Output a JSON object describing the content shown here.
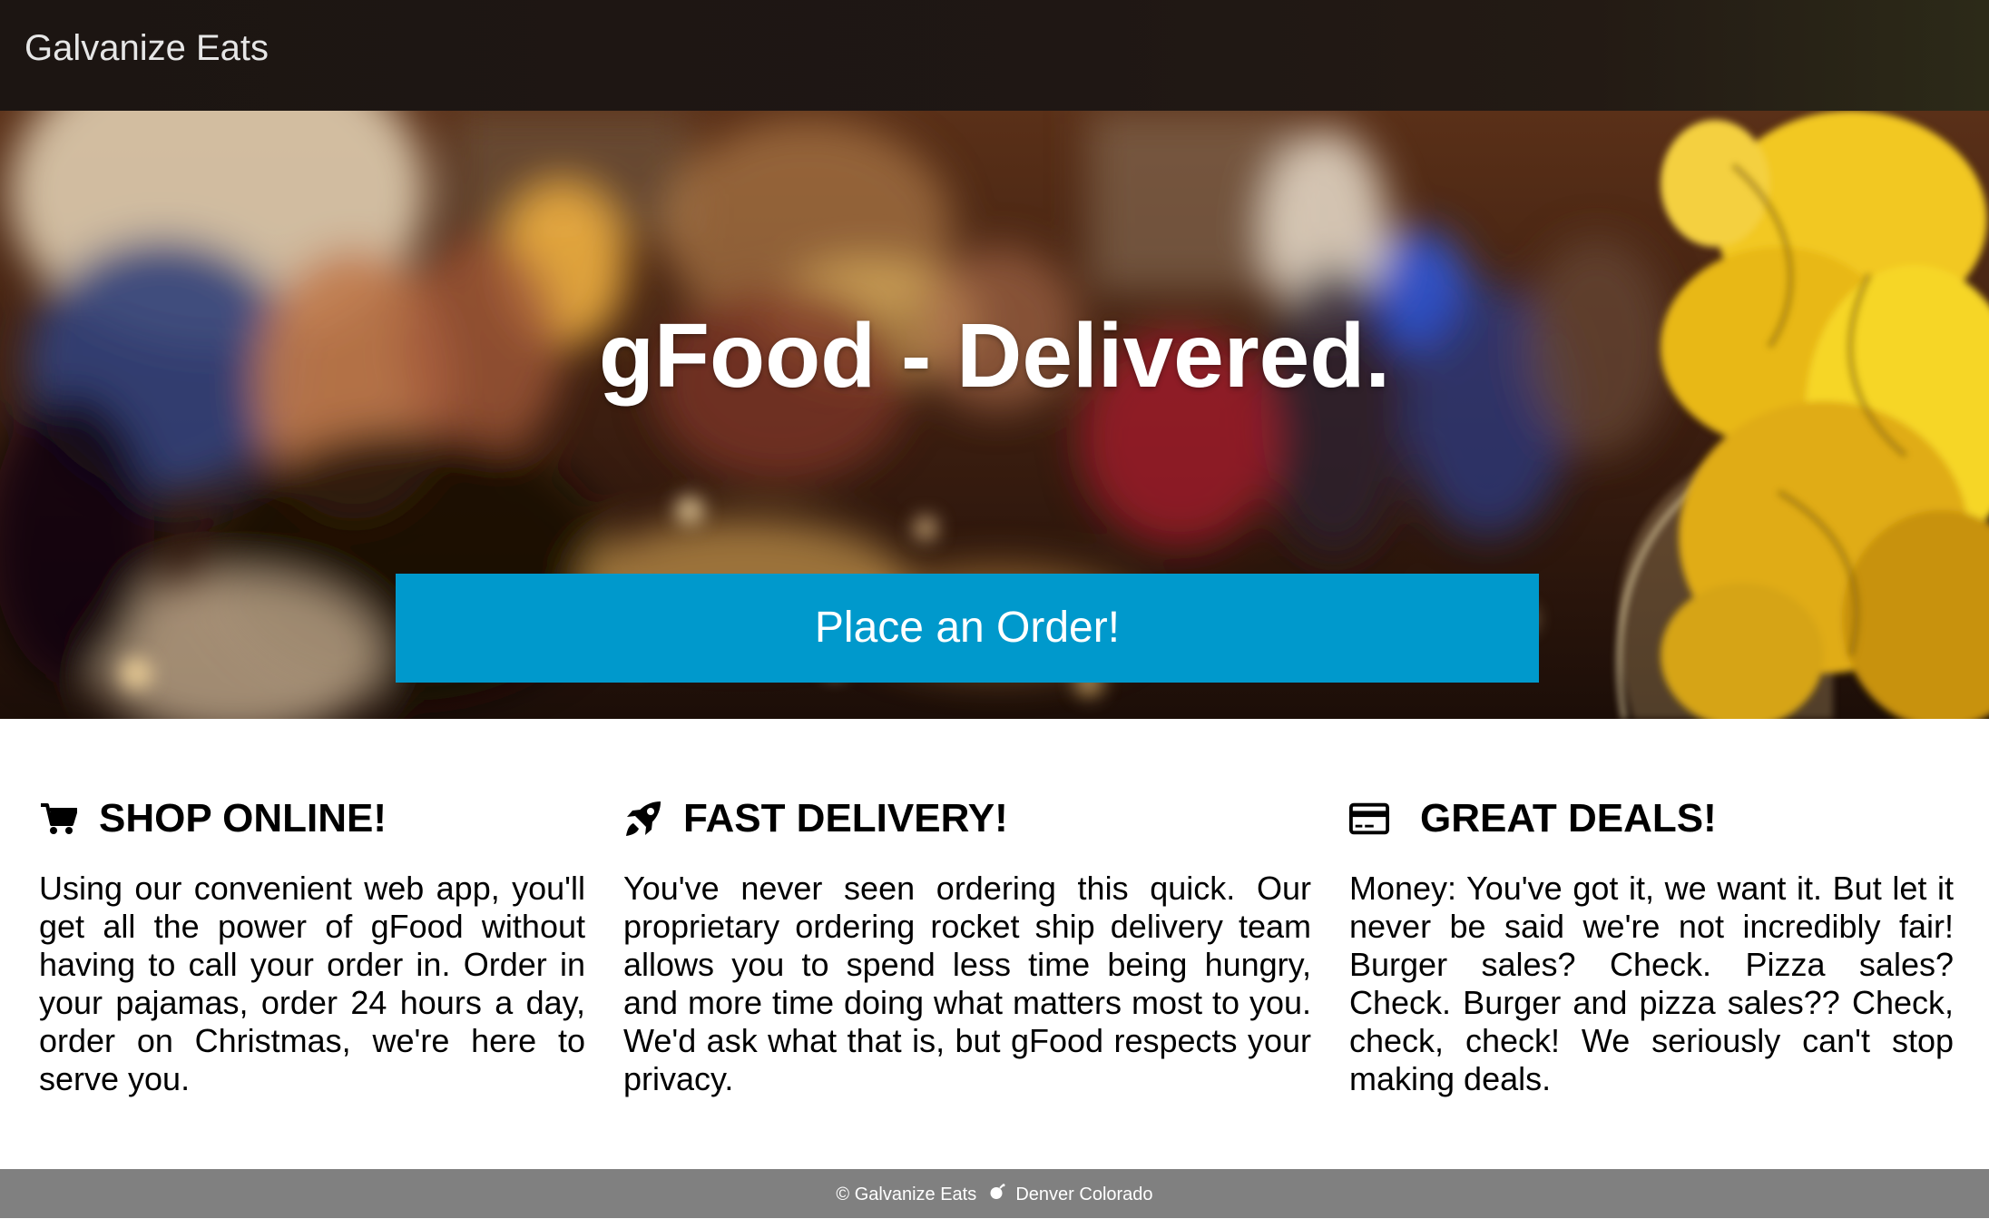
{
  "navbar": {
    "brand": "Galvanize Eats"
  },
  "hero": {
    "title": "gFood - Delivered.",
    "cta_label": "Place an Order!",
    "accent_color": "#0099cc"
  },
  "features": [
    {
      "icon": "shopping-cart-icon",
      "title": "SHOP ONLINE!",
      "text": "Using our convenient web app, you'll get all the power of gFood without having to call your order in. Order in your pajamas, order 24 hours a day, order on Christmas, we're here to serve you."
    },
    {
      "icon": "rocket-icon",
      "title": "FAST DELIVERY!",
      "text": "You've never seen ordering this quick. Our proprietary ordering rocket ship delivery team allows you to spend less time being hungry, and more time doing what matters most to you. We'd ask what that is, but gFood respects your privacy."
    },
    {
      "icon": "credit-card-icon",
      "title": "GREAT DEALS!",
      "text": "Money: You've got it, we want it. But let it never be said we're not incredibly fair! Burger sales? Check. Pizza sales? Check. Burger and pizza sales?? Check, check, check! We seriously can't stop making deals."
    }
  ],
  "footer": {
    "copyright": "© Galvanize Eats",
    "location": "Denver Colorado",
    "icon": "bomb-icon"
  }
}
